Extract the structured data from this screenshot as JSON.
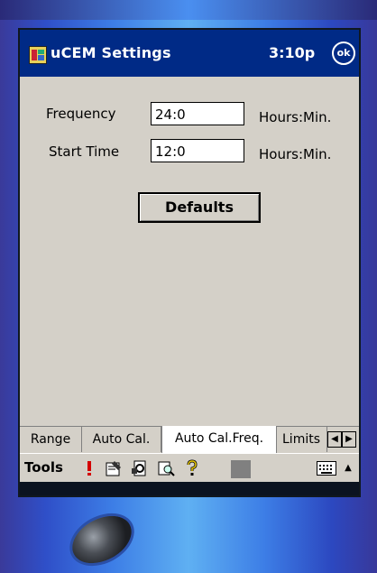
{
  "window": {
    "title": "uCEM Settings",
    "time": "3:10p",
    "ok_label": "ok"
  },
  "form": {
    "frequency": {
      "label": "Frequency",
      "value": "24:0",
      "unit": "Hours:Min."
    },
    "start_time": {
      "label": "Start Time",
      "value": "12:0",
      "unit": "Hours:Min."
    },
    "defaults_button": "Defaults"
  },
  "tabs": [
    {
      "label": "Range"
    },
    {
      "label": "Auto Cal."
    },
    {
      "label": "Auto Cal.Freq.",
      "active": true
    },
    {
      "label": "Limits"
    }
  ],
  "command_bar": {
    "tools_label": "Tools",
    "icons": [
      "exclamation-icon",
      "properties-icon",
      "sync-icon",
      "search-icon",
      "help-icon"
    ]
  },
  "colors": {
    "titlebar": "#002a86",
    "surface": "#d4d0c8",
    "alert": "#d40000"
  }
}
